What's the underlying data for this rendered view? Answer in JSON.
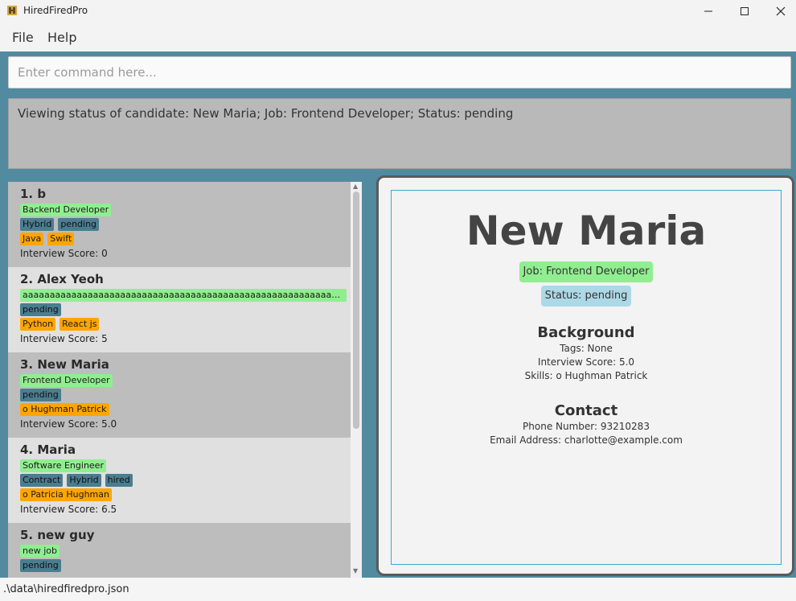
{
  "window": {
    "title": "HiredFiredPro"
  },
  "menu": {
    "file": "File",
    "help": "Help"
  },
  "command": {
    "placeholder": "Enter command here...",
    "value": ""
  },
  "result": {
    "text": "Viewing status of candidate: New Maria; Job: Frontend Developer; Status: pending"
  },
  "candidates": [
    {
      "name": "1. b",
      "job": "Backend Developer",
      "statuses": [
        "Hybrid",
        "pending"
      ],
      "skills": [
        "Java",
        "Swift"
      ],
      "score": "Interview Score: 0"
    },
    {
      "name": "2. Alex Yeoh",
      "job": "aaaaaaaaaaaaaaaaaaaaaaaaaaaaaaaaaaaaaaaaaaaaaaaaaaaaaaaaaaaaaaaaaaaa...",
      "statuses": [
        "pending"
      ],
      "skills": [
        "Python",
        "React js"
      ],
      "score": "Interview Score: 5"
    },
    {
      "name": "3. New Maria",
      "job": "Frontend Developer",
      "statuses": [
        "pending"
      ],
      "skills": [
        "o Hughman Patrick"
      ],
      "score": "Interview Score: 5.0"
    },
    {
      "name": "4. Maria",
      "job": "Software Engineer",
      "statuses": [
        "Contract",
        "Hybrid",
        "hired"
      ],
      "skills": [
        "o Patricia Hughman"
      ],
      "score": "Interview Score: 6.5"
    },
    {
      "name": "5. new guy",
      "job": "new job",
      "statuses": [
        "pending"
      ],
      "skills": [],
      "score": ""
    }
  ],
  "detail": {
    "name": "New Maria",
    "job": "Job: Frontend Developer",
    "status": "Status: pending",
    "background_heading": "Background",
    "tags": "Tags: None",
    "score": "Interview Score: 5.0",
    "skills": "Skills: o Hughman Patrick",
    "contact_heading": "Contact",
    "phone": "Phone Number: 93210283",
    "email": "Email Address: charlotte@example.com"
  },
  "statusbar": {
    "path": ".\\data\\hiredfiredpro.json"
  },
  "colors": {
    "panel": "#528a9f",
    "job_tag": "#90ee90",
    "status_tag": "#4a7d8f",
    "skill_tag": "#ffa500",
    "detail_border": "#3ea6cf"
  }
}
